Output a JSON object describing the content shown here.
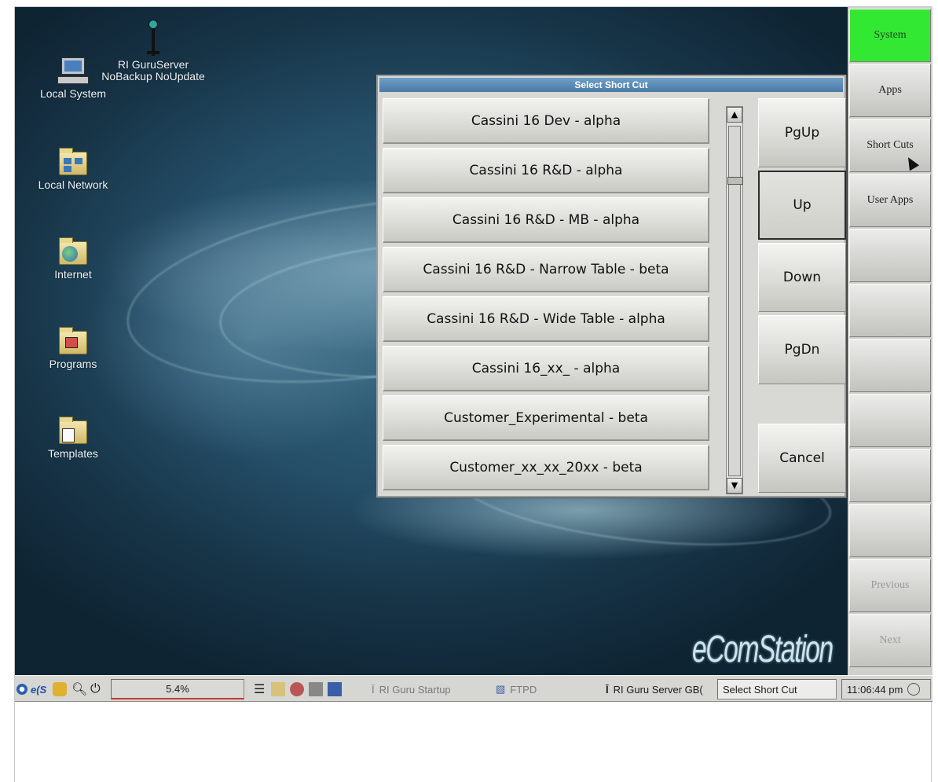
{
  "desktop": {
    "icons": [
      {
        "name": "Local System"
      },
      {
        "name": "RI GuruServer NoBackup NoUpdate",
        "line1": "RI GuruServer",
        "line2": "NoBackup NoUpdate"
      },
      {
        "name": "Local Network"
      },
      {
        "name": "Internet"
      },
      {
        "name": "Programs"
      },
      {
        "name": "Templates"
      }
    ],
    "logo_text": "eComStation"
  },
  "dialog": {
    "title": "Select Short Cut",
    "items": [
      "Cassini 16 Dev - alpha",
      "Cassini 16 R&D - alpha",
      "Cassini 16 R&D - MB - alpha",
      "Cassini 16 R&D - Narrow Table - beta",
      "Cassini 16 R&D - Wide Table - alpha",
      "Cassini 16_xx_ - alpha",
      "Customer_Experimental - beta",
      "Customer_xx_xx_20xx - beta"
    ],
    "buttons": {
      "pgup": "PgUp",
      "up": "Up",
      "down": "Down",
      "pgdn": "PgDn",
      "cancel": "Cancel"
    }
  },
  "right_panel": {
    "buttons": [
      "System",
      "Apps",
      "Short Cuts",
      "User Apps",
      "",
      "",
      "",
      "",
      "",
      "",
      "Previous",
      "Next"
    ],
    "active": "System",
    "active_color": "#33e833"
  },
  "taskbar": {
    "start": "e(S",
    "cpu": "5.4%",
    "tasks": [
      "RI Guru Startup",
      "FTPD",
      "RI Guru Server GB(",
      "Select Short Cut"
    ],
    "clock": "11:06:44 pm"
  }
}
